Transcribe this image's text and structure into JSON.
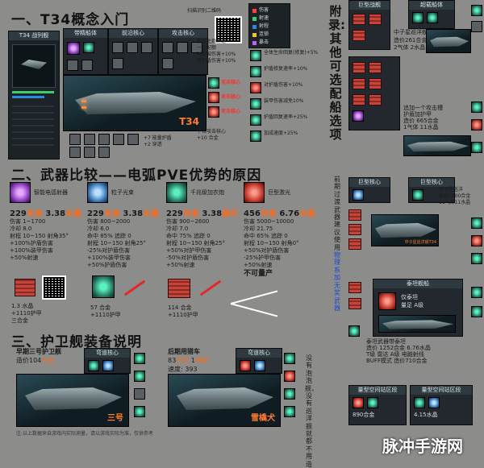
{
  "sections": {
    "s1_title": "一、T34概念入门",
    "s2_title": "二、武器比较——电弧PVE优势的原因",
    "s3_title": "三、护卫舰装备说明"
  },
  "appendix": {
    "title": "附录:其他可选配船选项",
    "note_pre": "前期过渡武器建议使用",
    "note_link": "物理系加无奖武器",
    "note_post": "没有泡泡舰，没有巡洋舰就都不用造"
  },
  "s1": {
    "panel_title": "T34 战列舰",
    "ship_label": "T34",
    "slots_header": [
      "带精船体",
      "前沿核心",
      "攻击核心"
    ],
    "side_labels": [
      "攻击核心",
      "攻击核心",
      "攻击核心"
    ],
    "qr_caption": "扫描识别二维码",
    "note_lines": [
      "加成主炮射速",
      "一个配额",
      "对范围伤害+10%",
      "对护盾伤害+10%"
    ],
    "bottom_notes": [
      "+7 能量护盾",
      "+2 穿透",
      "下位攻击核心",
      "+10 合金"
    ],
    "buff_legend": [
      "伤害",
      "射速",
      "射程",
      "连锁",
      "暴击"
    ],
    "buff_notes": [
      "全体生命回复(修复)+5%",
      "护盾修复速率+10%",
      "对护盾伤害+10%",
      "装甲伤害减免10%",
      "护盾回复速率+25%",
      "加成速度+25%"
    ]
  },
  "weapons": [
    {
      "name": "智能电弧射器",
      "tier": "II",
      "price": "229",
      "unit": "合金",
      "crystal": "3.38",
      "crystal_unit": "水晶",
      "stats": [
        "伤害 1~1700",
        "冷却 8.0",
        "射程 10~150 射角35°"
      ],
      "buffs": [
        "+100%护盾伤害",
        "+100%装甲伤害",
        "+50%射速"
      ],
      "buff_color": "green",
      "extra": [
        "1.3 水晶",
        "+1110护甲",
        "三合金"
      ]
    },
    {
      "name": "粒子光束",
      "tier": "II",
      "price": "229",
      "unit": "合金",
      "crystal": "3.38",
      "crystal_unit": "水晶",
      "stats": [
        "伤害 800~2000",
        "冷却 6.0",
        "命中 85% 追踪 0",
        "射程 10~150 射角25°"
      ],
      "buffs": [
        "-25%对护盾伤害",
        "+100%装甲伤害",
        "+50%护盾伤害"
      ],
      "buff_color": "mixed",
      "extra": [
        "57 合金",
        "+1110护甲"
      ]
    },
    {
      "name": "千兆级加农炮",
      "tier": "II",
      "price": "229",
      "unit": "合金",
      "crystal": "3.38",
      "crystal_unit": "晶石",
      "stats": [
        "伤害 900~2600",
        "冷却 7.0",
        "命中 75% 追踪 0",
        "射程 10~150 射角25°"
      ],
      "buffs": [
        "+50%对护甲伤害",
        "-50%对护盾伤害",
        "+50%射速"
      ],
      "buff_color": "mixed",
      "extra": [
        "114 合金",
        "+1110护甲"
      ]
    },
    {
      "name": "巨型激光",
      "tier": "",
      "price": "456",
      "unit": "合金",
      "crystal": "6.76",
      "crystal_unit": "水晶",
      "stats": [
        "伤害 5000~10000",
        "冷却 21.75",
        "命中 65% 追踪 0",
        "射程 10~150 射角0°"
      ],
      "buffs": [
        "+50%对护盾伤害",
        "-25%护甲伤害",
        "+50%射速"
      ],
      "buff_color": "mixed",
      "extra": [
        "不可量产"
      ]
    }
  ],
  "s3": {
    "left_title": "早期三号护卫舰",
    "left_cost_label": "造价",
    "left_cost": "104",
    "left_cost_unit": "合金",
    "left_ship_label": "三号",
    "left_slot_header": "弯道核心",
    "right_title": "后期用猎车",
    "right_cost_a": "83",
    "right_cost_a_unit": "合金",
    "right_cost_b": "1",
    "right_cost_b_unit": "稀缺",
    "right_speed_label": "速度:",
    "right_speed": "393",
    "right_ship_label": "雪橇犬",
    "right_slot_header": "弯道核心",
    "footnote": "注:以上数据来自游戏内实际测量，请以游戏实际为准，仅供参考"
  },
  "right_panels": {
    "top_ship_hdr": [
      "巨型战舰",
      "超载船体"
    ],
    "cruiser_title": "中子星巡洋舰",
    "cruiser_lines": [
      "造价261合金",
      "2气体 2水晶"
    ],
    "sub_title": "中子星巡洋舰",
    "sub_lines": [
      "追加一个攻击槽",
      "护盾加护甲",
      "造价 665合金",
      "1气体 11水晶"
    ],
    "mid_hdr": [
      "巨型核心",
      "巨型核心"
    ],
    "mid_ship_label": "中子星巡洋舰T34",
    "mid_lines": [
      "中子星巡洋",
      "造价1200合金",
      "11气体11水晶"
    ],
    "raider_hdr": "泰坦舰船",
    "raider_lines": [
      "仅泰坦",
      "量足 A级"
    ],
    "titan_lines": [
      "泰坦武器带泰坦",
      "造价 1252合金 6.76水晶",
      "T级 雷达 A级 电脑射线",
      "BUFF模式 造价710合金"
    ],
    "titan_price": "造价710合金",
    "bottom_hdr": [
      "量型空间站区段",
      "量型空间站区段"
    ],
    "bottom_price": "890合金",
    "bottom_sub": "4.15水晶"
  },
  "watermark": "脉冲手游网"
}
